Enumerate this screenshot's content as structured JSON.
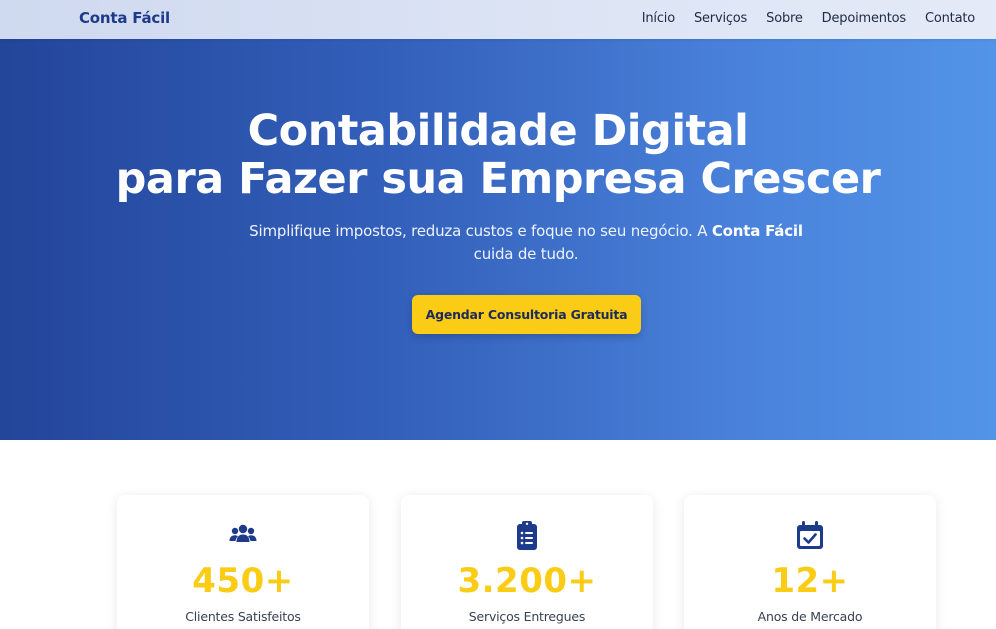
{
  "nav": {
    "brand": "Conta Fácil",
    "links": [
      "Início",
      "Serviços",
      "Sobre",
      "Depoimentos",
      "Contato"
    ]
  },
  "hero": {
    "title_line1": "Contabilidade Digital",
    "title_line2": "para Fazer sua Empresa Crescer",
    "subtitle_before": "Simplifique impostos, reduza custos e foque no seu negócio. A ",
    "subtitle_brand": "Conta Fácil",
    "subtitle_after": " cuida de tudo.",
    "cta_label": "Agendar Consultoria Gratuita"
  },
  "stats": [
    {
      "icon": "users-icon",
      "value": "450+",
      "label": "Clientes Satisfeitos"
    },
    {
      "icon": "clipboard-list-icon",
      "value": "3.200+",
      "label": "Serviços Entregues"
    },
    {
      "icon": "calendar-check-icon",
      "value": "12+",
      "label": "Anos de Mercado"
    }
  ],
  "colors": {
    "brand": "#1e3a8a",
    "accent": "#facc15",
    "hero_start": "#23459a",
    "hero_end": "#5294e8",
    "icon": "#1e3a8a"
  }
}
